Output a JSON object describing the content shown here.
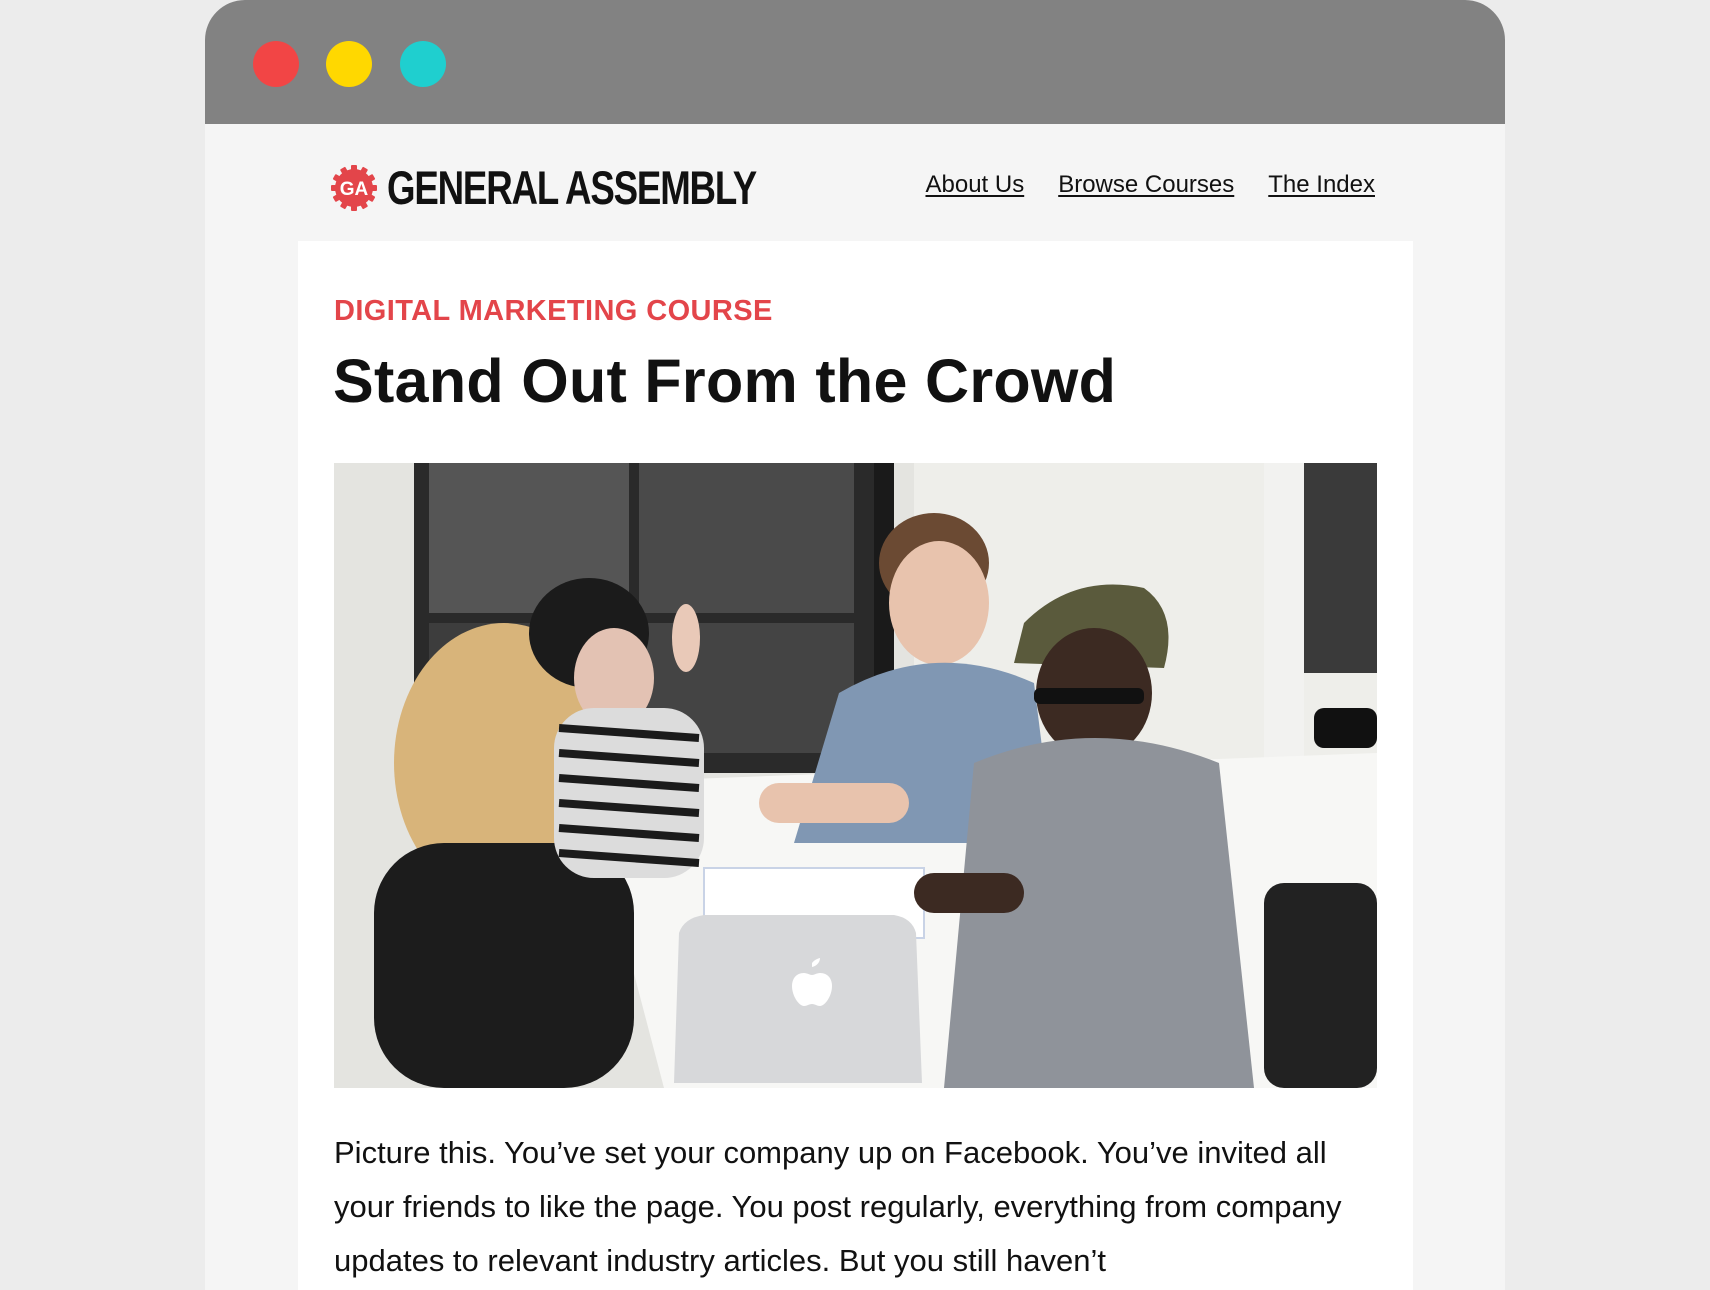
{
  "window": {
    "controls": [
      {
        "name": "close",
        "color": "#f24545"
      },
      {
        "name": "minimize",
        "color": "#ffd800"
      },
      {
        "name": "maximize",
        "color": "#1fcfcf"
      }
    ],
    "titlebar_color": "#828282"
  },
  "header": {
    "logo_badge": "GA",
    "logo_text": "GENERAL ASSEMBLY",
    "brand_color": "#e3454a",
    "nav": [
      "About Us",
      "Browse Courses",
      "The Index"
    ]
  },
  "article": {
    "eyebrow": "DIGITAL MARKETING COURSE",
    "title": "Stand Out From the Crowd",
    "hero_image": "group-meeting-photo",
    "body": "Picture this. You’ve set your company up on Facebook. You’ve invited all your friends to like the page. You post regularly, everything from company updates to relevant industry articles. But you still haven’t"
  }
}
